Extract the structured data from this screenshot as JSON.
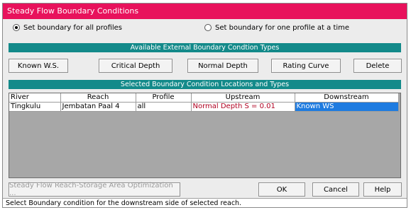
{
  "window": {
    "title": "Steady Flow Boundary Conditions"
  },
  "options": {
    "all_profiles_label": "Set boundary for all profiles",
    "one_profile_label": "Set boundary for one profile at a time",
    "selected": "all_profiles"
  },
  "external_types": {
    "header": "Available External Boundary Condtion Types",
    "buttons": {
      "known_ws": "Known W.S.",
      "critical_depth": "Critical Depth",
      "normal_depth": "Normal Depth",
      "rating_curve": "Rating Curve",
      "delete": "Delete"
    }
  },
  "locations": {
    "header": "Selected Boundary Condition Locations and Types",
    "columns": [
      "River",
      "Reach",
      "Profile",
      "Upstream",
      "Downstream"
    ],
    "rows": [
      {
        "river": "Tingkulu",
        "reach": "Jembatan Paal 4",
        "profile": "all",
        "upstream": "Normal Depth S = 0.01",
        "downstream": "Known WS"
      }
    ]
  },
  "footer_buttons": {
    "optimization": "Steady Flow Reach-Storage Area Optimization ...",
    "ok": "OK",
    "cancel": "Cancel",
    "help": "Help"
  },
  "status": {
    "text": "Select Boundary condition for the downstream side of selected reach."
  },
  "colors": {
    "titlebar": "#e8125c",
    "section_bar": "#138a8a",
    "upstream_text": "#b00020",
    "selection": "#1e7be0"
  }
}
